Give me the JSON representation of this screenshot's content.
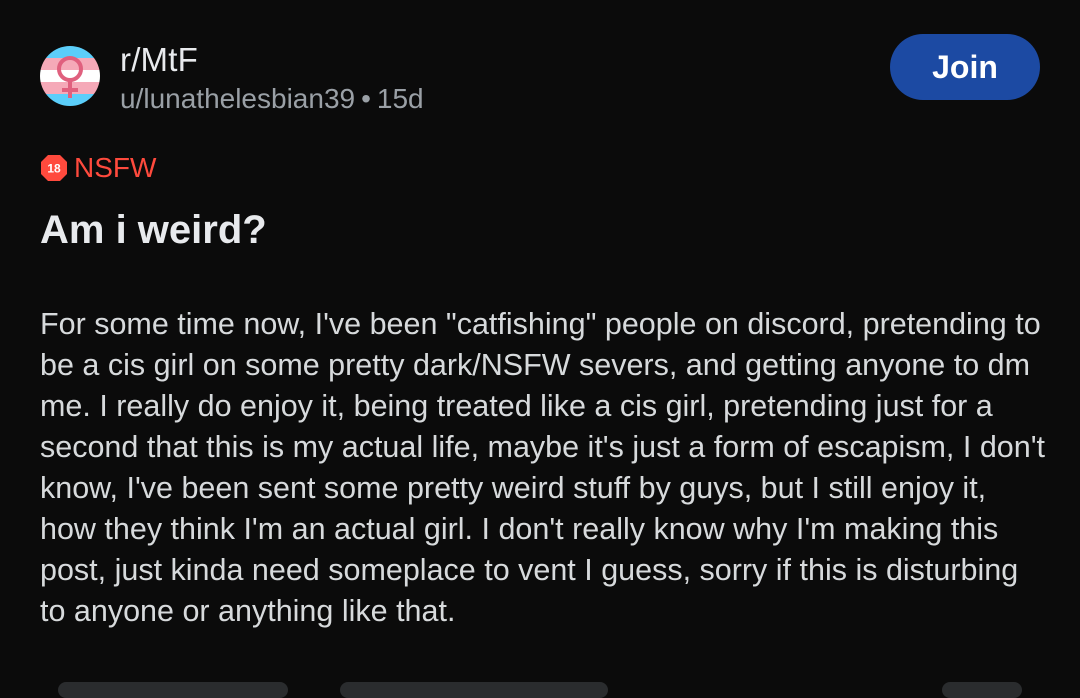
{
  "post": {
    "subreddit": "r/MtF",
    "author": "u/lunathelesbian39",
    "separator": "•",
    "age": "15d",
    "join_label": "Join",
    "nsfw_icon_text": "18",
    "nsfw_label": "NSFW",
    "title": "Am i weird?",
    "body": "For some time now, I've been \"catfishing\" people on discord, pretending to be a cis girl on some pretty dark/NSFW severs, and getting anyone to dm me. I really do enjoy it, being treated like a cis girl, pretending just for a second that this is my actual life, maybe it's just a form of escapism, I don't know, I've been sent some pretty weird stuff by guys, but I still enjoy it, how they think I'm an actual girl. I don't really know why I'm making this post, just kinda need someplace to vent I guess, sorry if this is disturbing to anyone or anything like that."
  },
  "icons": {
    "avatar": "transgender-flag-venus-icon",
    "nsfw": "nsfw-18-badge-icon"
  },
  "colors": {
    "background": "#0b0b0b",
    "join_button": "#1c4aa3",
    "nsfw": "#ff4a3d",
    "trans_blue": "#5bcefa",
    "trans_pink": "#f5a9b8",
    "venus_symbol": "#e0607e"
  }
}
